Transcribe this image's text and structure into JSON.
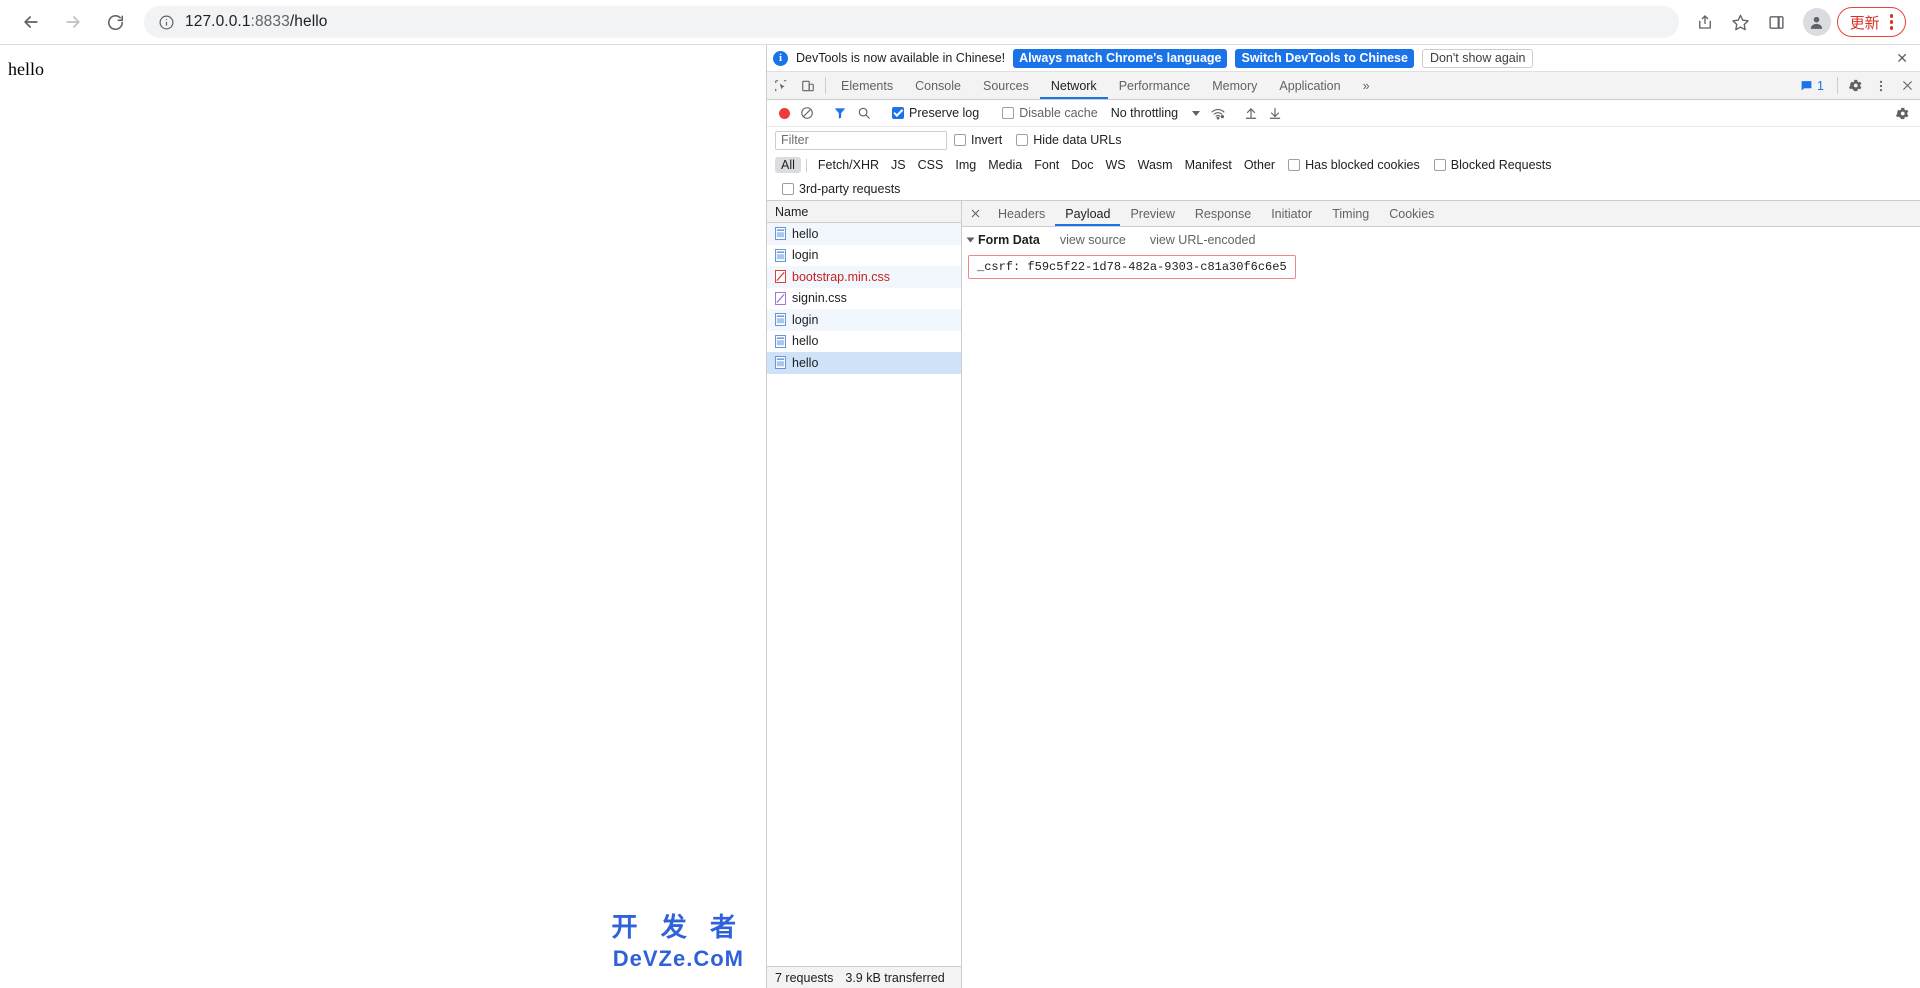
{
  "browser": {
    "back_label": "Back",
    "forward_label": "Forward",
    "reload_label": "Reload",
    "url_host": "127.0.0.1",
    "url_port": ":8833",
    "url_path": "/hello",
    "share_label": "Share this page",
    "bookmark_label": "Bookmark this tab",
    "sidepanel_label": "Side panel",
    "profile_label": "Profile",
    "update_label": "更新",
    "menu_label": "Customize and control Chrome",
    "accent_red": "#d93025"
  },
  "page": {
    "body_text": "hello",
    "watermark_line1": "开 发 者",
    "watermark_line2": "DeVZe.CoM"
  },
  "devtools": {
    "banner": {
      "message": "DevTools is now available in Chinese!",
      "primary_button": "Always match Chrome's language",
      "secondary_button": "Switch DevTools to Chinese",
      "dismiss_button": "Don't show again",
      "close_label": "Close",
      "blue": "#1a73e8"
    },
    "tabs": [
      {
        "label": "Elements",
        "active": false
      },
      {
        "label": "Console",
        "active": false
      },
      {
        "label": "Sources",
        "active": false
      },
      {
        "label": "Network",
        "active": true
      },
      {
        "label": "Performance",
        "active": false
      },
      {
        "label": "Memory",
        "active": false
      },
      {
        "label": "Application",
        "active": false
      }
    ],
    "more_tabs_label": "»",
    "message_count": "1",
    "settings_label": "Settings",
    "more_options_label": "More options",
    "close_label": "Close DevTools",
    "inspect_label": "Inspect element",
    "device_toolbar_label": "Toggle device toolbar",
    "network": {
      "record_label": "Stop recording network log",
      "clear_label": "Clear network log",
      "filter_toggle_label": "Filter",
      "search_label": "Search",
      "preserve_log": "Preserve log",
      "preserve_log_checked": true,
      "disable_cache": "Disable cache",
      "disable_cache_checked": false,
      "throttling": "No throttling",
      "network_conditions_label": "More network conditions",
      "import_label": "Import HAR file",
      "export_label": "Export HAR",
      "filter_placeholder": "Filter",
      "filter_value": "",
      "invert": "Invert",
      "invert_checked": false,
      "hide_data_urls": "Hide data URLs",
      "hide_data_urls_checked": false,
      "has_blocked_cookies": "Has blocked cookies",
      "has_blocked_cookies_checked": false,
      "blocked_requests": "Blocked Requests",
      "blocked_requests_checked": false,
      "third_party_requests": "3rd-party requests",
      "third_party_checked": false,
      "type_filters": [
        {
          "label": "All",
          "active": true
        },
        {
          "label": "Fetch/XHR",
          "active": false
        },
        {
          "label": "JS",
          "active": false
        },
        {
          "label": "CSS",
          "active": false
        },
        {
          "label": "Img",
          "active": false
        },
        {
          "label": "Media",
          "active": false
        },
        {
          "label": "Font",
          "active": false
        },
        {
          "label": "Doc",
          "active": false
        },
        {
          "label": "WS",
          "active": false
        },
        {
          "label": "Wasm",
          "active": false
        },
        {
          "label": "Manifest",
          "active": false
        },
        {
          "label": "Other",
          "active": false
        }
      ],
      "column_name": "Name",
      "requests": [
        {
          "name": "hello",
          "type": "doc",
          "state": "alt",
          "error": false
        },
        {
          "name": "login",
          "type": "doc",
          "state": "plain",
          "error": false
        },
        {
          "name": "bootstrap.min.css",
          "type": "css",
          "state": "alt",
          "error": true
        },
        {
          "name": "signin.css",
          "type": "css",
          "state": "plain",
          "error": false
        },
        {
          "name": "login",
          "type": "doc",
          "state": "alt",
          "error": false
        },
        {
          "name": "hello",
          "type": "doc",
          "state": "plain",
          "error": false
        },
        {
          "name": "hello",
          "type": "doc",
          "state": "sel",
          "error": false
        }
      ],
      "footer_requests": "7 requests",
      "footer_transferred": "3.9 kB transferred"
    },
    "detail": {
      "close_label": "Close",
      "tabs": [
        {
          "label": "Headers",
          "active": false
        },
        {
          "label": "Payload",
          "active": true
        },
        {
          "label": "Preview",
          "active": false
        },
        {
          "label": "Response",
          "active": false
        },
        {
          "label": "Initiator",
          "active": false
        },
        {
          "label": "Timing",
          "active": false
        },
        {
          "label": "Cookies",
          "active": false
        }
      ],
      "payload": {
        "section_title": "Form Data",
        "view_source": "view source",
        "view_url_encoded": "view URL-encoded",
        "fields": [
          {
            "key": "_csrf:",
            "value": "f59c5f22-1d78-482a-9303-c81a30f6c6e5"
          }
        ],
        "highlight_color": "#e88888"
      }
    }
  }
}
